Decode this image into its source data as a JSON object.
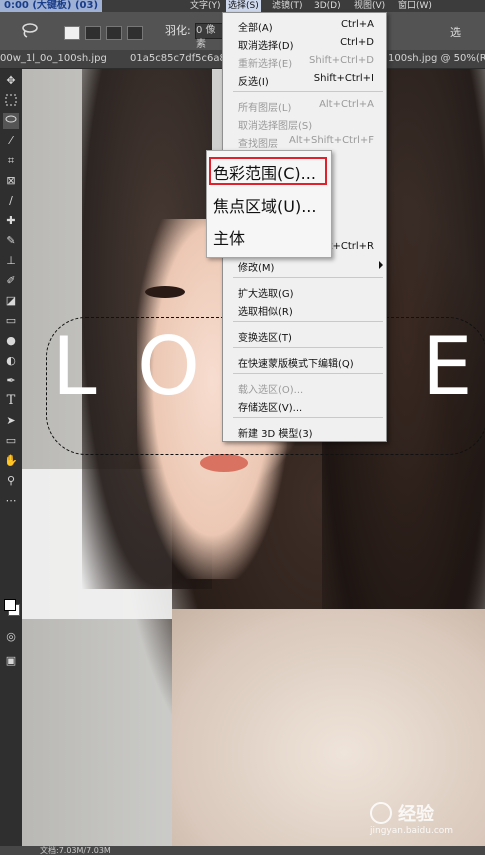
{
  "app": {
    "title_fragment": "0:00 (大键板) (03)"
  },
  "menubar": {
    "items": [
      {
        "label": "文字(Y)"
      },
      {
        "label": "选择(S)"
      },
      {
        "label": "滤镜(T)"
      },
      {
        "label": "3D(D)"
      },
      {
        "label": "视图(V)"
      },
      {
        "label": "窗口(W)"
      }
    ]
  },
  "options_bar": {
    "feather_label": "羽化:",
    "feather_value": "0 像素",
    "right_text": "选"
  },
  "tabs": [
    {
      "label": "00w_1l_0o_100sh.jpg"
    },
    {
      "label": "01a5c85c7df5c6a80"
    },
    {
      "label": "100sh.jpg @ 50%(RGB"
    }
  ],
  "canvas": {
    "love_letters": [
      "L",
      "O",
      "E"
    ]
  },
  "select_menu": {
    "groups": [
      [
        {
          "label": "全部(A)",
          "shortcut": "Ctrl+A",
          "enabled": true
        },
        {
          "label": "取消选择(D)",
          "shortcut": "Ctrl+D",
          "enabled": true
        },
        {
          "label": "重新选择(E)",
          "shortcut": "Shift+Ctrl+D",
          "enabled": false
        },
        {
          "label": "反选(I)",
          "shortcut": "Shift+Ctrl+I",
          "enabled": true
        }
      ],
      [
        {
          "label": "所有图层(L)",
          "shortcut": "Alt+Ctrl+A",
          "enabled": false
        },
        {
          "label": "取消选择图层(S)",
          "shortcut": "",
          "enabled": false
        },
        {
          "label": "查找图层",
          "shortcut": "Alt+Shift+Ctrl+F",
          "enabled": false
        }
      ],
      [
        {
          "label": "修改(M)",
          "shortcut": "",
          "enabled": true,
          "submenu": true
        }
      ],
      [
        {
          "label": "扩大选取(G)",
          "shortcut": "",
          "enabled": true
        },
        {
          "label": "选取相似(R)",
          "shortcut": "",
          "enabled": true
        }
      ],
      [
        {
          "label": "变换选区(T)",
          "shortcut": "",
          "enabled": true
        }
      ],
      [
        {
          "label": "在快速蒙版模式下编辑(Q)",
          "shortcut": "",
          "enabled": true
        }
      ],
      [
        {
          "label": "载入选区(O)...",
          "shortcut": "",
          "enabled": false
        },
        {
          "label": "存储选区(V)...",
          "shortcut": "",
          "enabled": true
        }
      ],
      [
        {
          "label": "新建 3D 模型(3)",
          "shortcut": "",
          "enabled": true
        }
      ]
    ],
    "hidden_shortcut": "t+Ctrl+R"
  },
  "submenu": {
    "items": [
      {
        "label": "色彩范围(C)...",
        "highlighted": true
      },
      {
        "label": "焦点区域(U)..."
      },
      {
        "label": "主体"
      }
    ],
    "highlight_color": "#e0202a"
  },
  "status": {
    "text": "文档:7.03M/7.03M"
  },
  "watermark": {
    "text": "经验",
    "url": "jingyan.baidu.com"
  }
}
